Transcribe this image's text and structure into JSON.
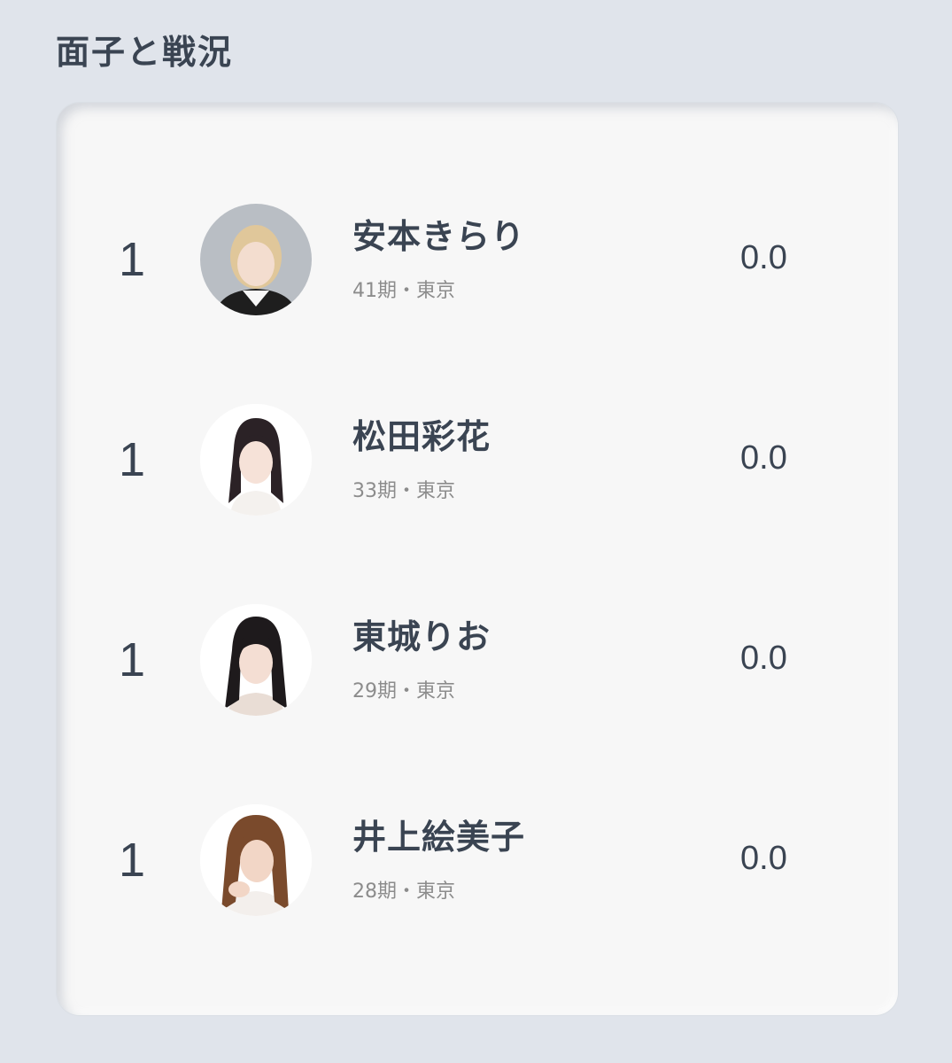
{
  "section": {
    "title": "面子と戦況"
  },
  "players": [
    {
      "rank": "1",
      "name": "安本きらり",
      "meta": "41期・東京",
      "score": "0.0",
      "avatar": {
        "bg": "#b9bec4",
        "hair": "#e0c79a",
        "skin": "#f3ddcf",
        "cloth": "#1e1e1e"
      }
    },
    {
      "rank": "1",
      "name": "松田彩花",
      "meta": "33期・東京",
      "score": "0.0",
      "avatar": {
        "bg": "#ffffff",
        "hair": "#2b2226",
        "skin": "#f6e2d8",
        "cloth": "#f4f1ee"
      }
    },
    {
      "rank": "1",
      "name": "東城りお",
      "meta": "29期・東京",
      "score": "0.0",
      "avatar": {
        "bg": "#ffffff",
        "hair": "#1e1a1c",
        "skin": "#f4ded3",
        "cloth": "#e9ddd5"
      }
    },
    {
      "rank": "1",
      "name": "井上絵美子",
      "meta": "28期・東京",
      "score": "0.0",
      "avatar": {
        "bg": "#ffffff",
        "hair": "#7a4a2c",
        "skin": "#f2d6c6",
        "cloth": "#f3efec"
      }
    }
  ]
}
